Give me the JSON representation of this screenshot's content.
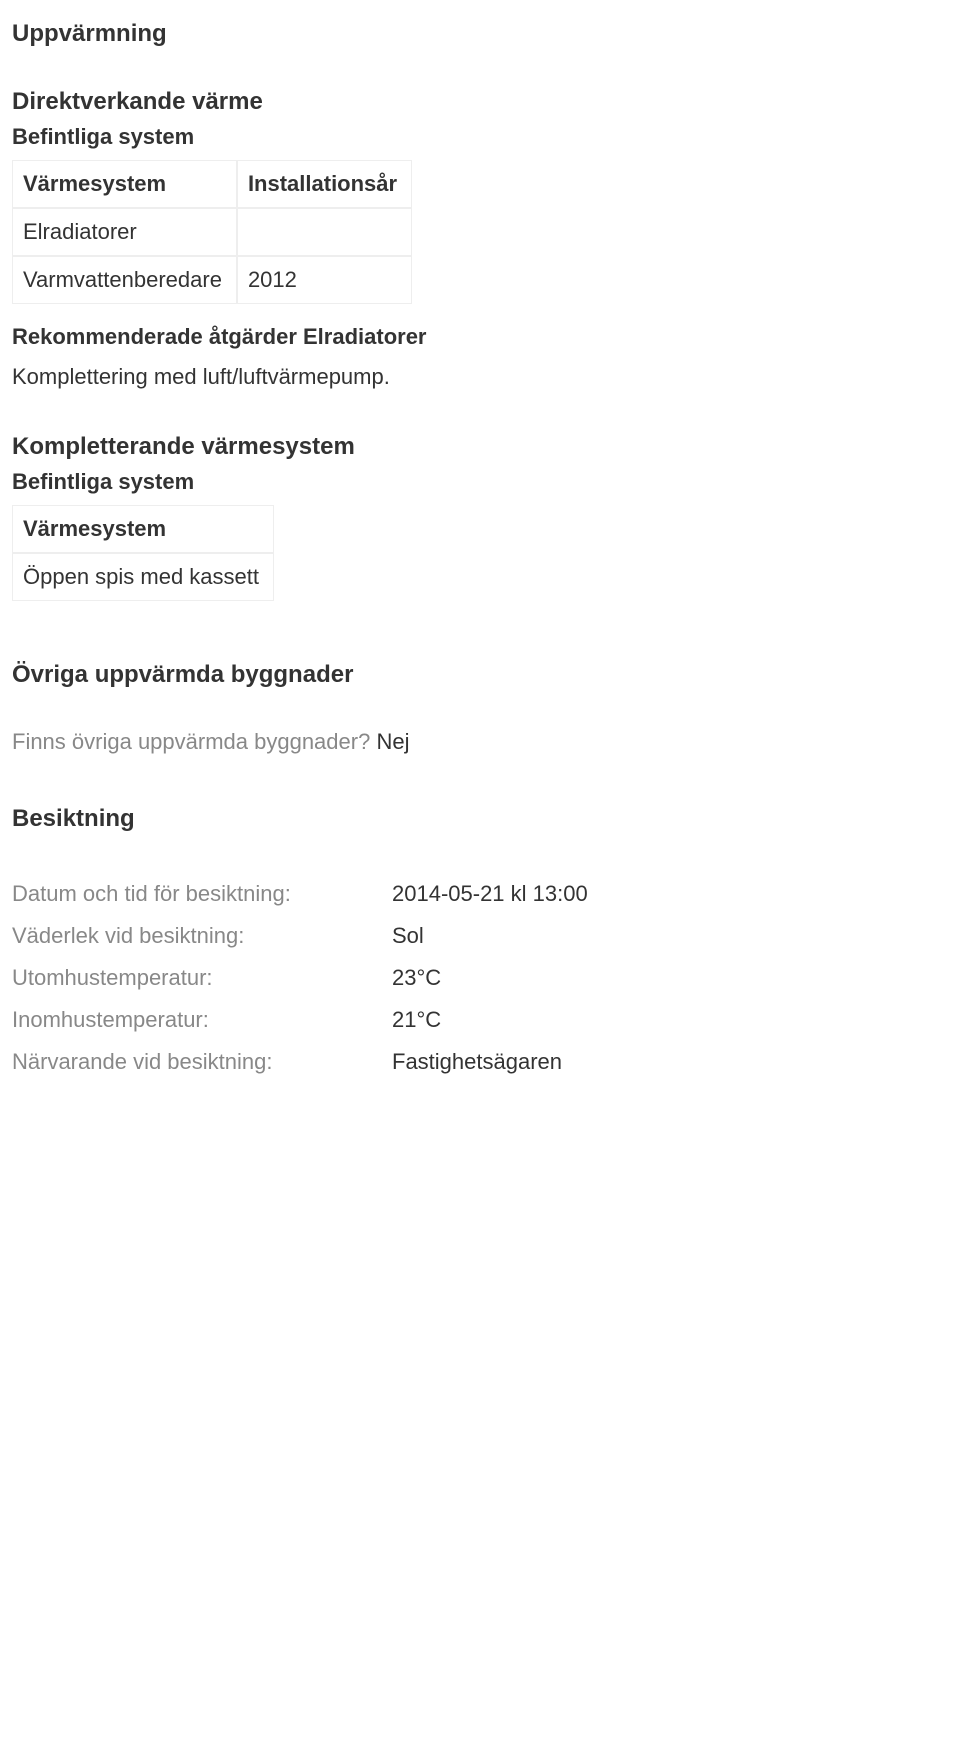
{
  "uppvarmning": {
    "title": "Uppvärmning",
    "direkt": {
      "title": "Direktverkande värme",
      "befintliga_label": "Befintliga system",
      "table": {
        "headers": [
          "Värmesystem",
          "Installationsår"
        ],
        "rows": [
          [
            "Elradiatorer",
            ""
          ],
          [
            "Varmvattenberedare",
            "2012"
          ]
        ]
      },
      "rek_title": "Rekommenderade åtgärder Elradiatorer",
      "rek_text": "Komplettering med luft/luftvärmepump."
    },
    "komplett": {
      "title": "Kompletterande värmesystem",
      "befintliga_label": "Befintliga system",
      "table": {
        "headers": [
          "Värmesystem"
        ],
        "rows": [
          [
            "Öppen spis med kassett"
          ]
        ]
      }
    }
  },
  "ovriga": {
    "title": "Övriga uppvärmda byggnader",
    "question": "Finns övriga uppvärmda byggnader?",
    "answer": "Nej"
  },
  "besiktning": {
    "title": "Besiktning",
    "rows": [
      {
        "key": "Datum och tid för besiktning:",
        "val": "2014-05-21 kl 13:00"
      },
      {
        "key": "Väderlek vid besiktning:",
        "val": "Sol"
      },
      {
        "key": "Utomhustemperatur:",
        "val": "23°C"
      },
      {
        "key": "Inomhustemperatur:",
        "val": "21°C"
      },
      {
        "key": "Närvarande vid besiktning:",
        "val": "Fastighetsägaren"
      }
    ]
  }
}
